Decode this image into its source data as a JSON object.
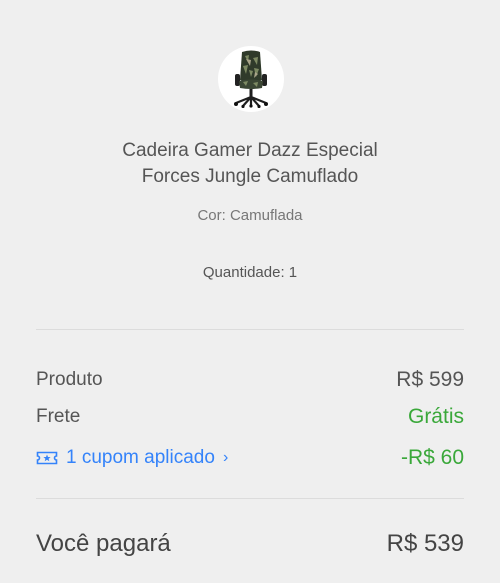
{
  "product": {
    "image_icon": "gaming-chair-camouflage",
    "title_line1": "Cadeira Gamer Dazz Especial",
    "title_line2": "Forces Jungle Camuflado",
    "variant": "Cor: Camuflada",
    "quantity": "Quantidade: 1"
  },
  "summary": {
    "product_label": "Produto",
    "product_value": "R$ 599",
    "shipping_label": "Frete",
    "shipping_value": "Grátis",
    "coupon_icon": "coupon-ticket-icon",
    "coupon_label": "1 cupom aplicado",
    "coupon_chevron": "›",
    "coupon_value": "-R$ 60",
    "total_label": "Você pagará",
    "total_value": "R$ 539"
  },
  "colors": {
    "background": "#efefef",
    "accent_blue": "#3483fa",
    "success_green": "#3aa83a"
  }
}
